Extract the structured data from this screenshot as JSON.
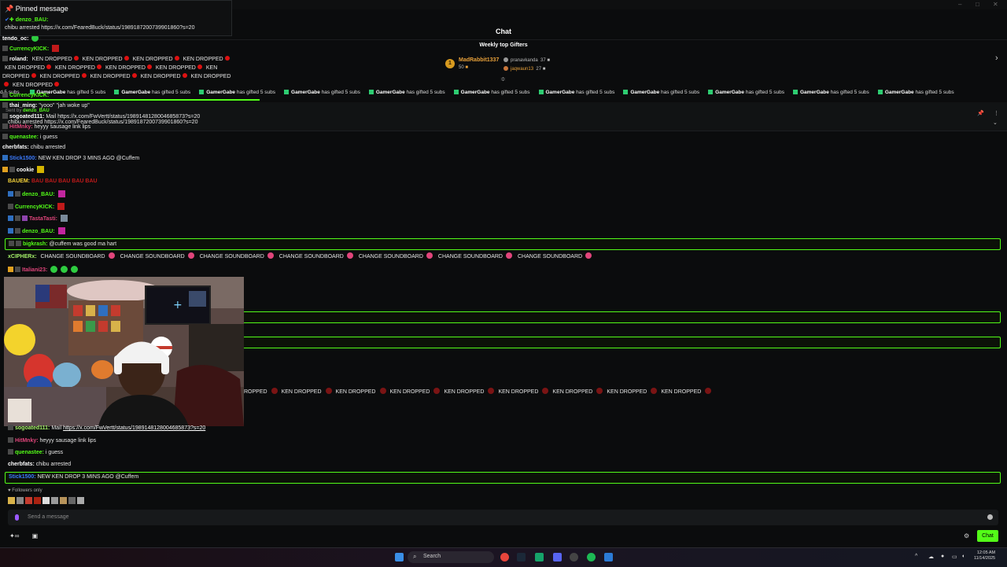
{
  "pinned": {
    "header": "Pinned message",
    "user": "denzo_BAU:",
    "text": "chibu arrested https://x.com/FearedBuck/status/1989187200739901860?s=20",
    "sent_by": "Sent by",
    "sent_by_user": "denzo_BAU",
    "strip_text": "chibu arrested https://x.com/FearedBuck/status/1989187200739901860?s=20"
  },
  "header": {
    "title": "Chat"
  },
  "gifters": {
    "title": "Weekly top Gifters",
    "rank1": {
      "medal": "1",
      "name": "MadRabbit1337",
      "count": "50"
    },
    "rank2": {
      "name": "pranavkanda",
      "count": "37"
    },
    "rank3": {
      "name": "jaqwaun13",
      "count": "27"
    }
  },
  "ticker": {
    "user": "GamerGabe",
    "text": "has gifted 5 subs",
    "prefix": "d 5 subs"
  },
  "top_messages": [
    {
      "user": "tendo_oc:",
      "text": ""
    },
    {
      "user": "CurrencyKICK:",
      "text": ""
    },
    {
      "user": "roland:",
      "text": "KEN DROPPED"
    },
    {
      "user": "thai_ming:",
      "text": "\"yooo\" \"jah woke up\""
    },
    {
      "user": "sogoated111:",
      "text": "Mail https://x.com/FwVertt/status/1989148128004685873?s=20"
    },
    {
      "user": "HitMnky:",
      "text": "heyyy sausage link lips"
    },
    {
      "user": "quenastee:",
      "text": "i guess"
    },
    {
      "user": "cherbfats:",
      "text": "chibu arrested"
    },
    {
      "user": "Stick1500:",
      "text": "NEW KEN DROP 3 MINS AGO @Cuffem"
    },
    {
      "user": "cookie",
      "text": ""
    }
  ],
  "ken_text": "KEN DROPPED",
  "messages": [
    {
      "user": "BAUEM:",
      "text": "BAU BAU BAU BAU BAU"
    },
    {
      "user": "denzo_BAU:",
      "text": ""
    },
    {
      "user": "CurrencyKICK:",
      "text": ""
    },
    {
      "user": "TastaTasti:",
      "text": ""
    },
    {
      "user": "denzo_BAU:",
      "text": ""
    },
    {
      "user": "bigkrash:",
      "text": "@cuffem was good ma hart"
    },
    {
      "user": "xCIPHERx:",
      "text": "CHANGE SOUNDBOARD"
    },
    {
      "user": "Italiani23:",
      "text": ""
    },
    {
      "user": "sogoated111:",
      "text": "Mail ",
      "link": "https://x.com/FwVertt/status/1989148128004685873?s=20"
    },
    {
      "user": "HitMnky:",
      "text": "heyyy sausage link lips"
    },
    {
      "user": "quenastee:",
      "text": "i guess"
    },
    {
      "user": "cherbfats:",
      "text": "chibu arrested"
    },
    {
      "user": "Stick1500:",
      "text": "NEW KEN DROP 3 MINS AGO @Cuffem"
    }
  ],
  "ken_row_first": "ROPPED",
  "cam_tv_text": "+",
  "followers_only": "Followers only",
  "input": {
    "placeholder": "Send a message"
  },
  "chat_button": "Chat",
  "taskbar": {
    "search": "Search",
    "date": "11/14/2025",
    "time": "12:05 AM"
  },
  "colors": {
    "accent": "#53fc18",
    "highlight_border": "#53fc18",
    "danger": "#d11111"
  }
}
